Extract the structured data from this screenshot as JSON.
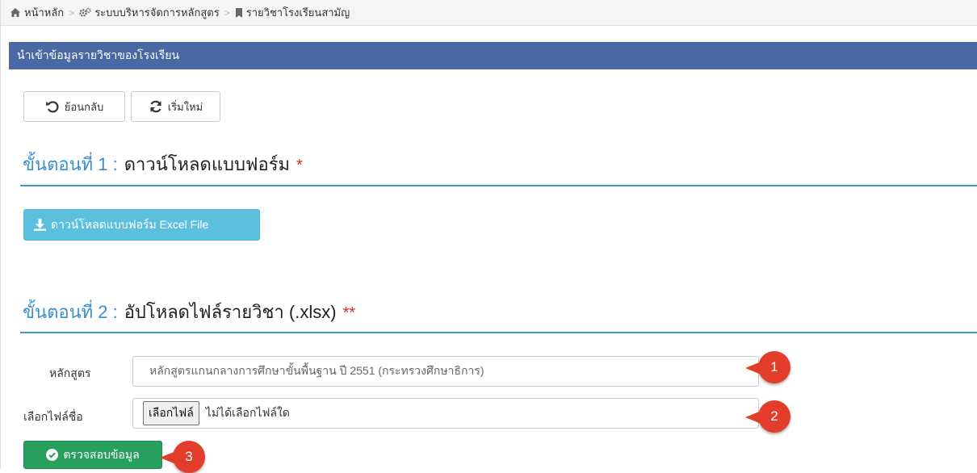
{
  "breadcrumb": {
    "home": "หน้าหลัก",
    "system": "ระบบบริหารจัดการหลักสูตร",
    "current": "รายวิชาโรงเรียนสามัญ"
  },
  "panel": {
    "title": "นำเข้าข้อมูลรายวิชาของโรงเรียน"
  },
  "toolbar": {
    "back_label": "ย้อนกลับ",
    "reset_label": "เริ่มใหม่"
  },
  "step1": {
    "number": "ขั้นตอนที่ 1 :",
    "title": "ดาวน์โหลดแบบฟอร์ม",
    "required": "*",
    "download_label": "ดาวน์โหลดแบบฟอร์ม Excel File"
  },
  "step2": {
    "number": "ขั้นตอนที่ 2 :",
    "title": "อัปโหลดไฟล์รายวิชา (.xlsx)",
    "required": "**"
  },
  "form": {
    "course_label": "หลักสูตร",
    "course_value": "หลักสูตรแกนกลางการศึกษาขั้นพื้นฐาน ปี 2551 (กระทรวงศึกษาธิการ)",
    "file_label": "เลือกไฟล์ชื่อ",
    "choose_file_label": "เลือกไฟล์",
    "no_file_text": "ไม่ได้เลือกไฟล์ใด",
    "verify_label": "ตรวจสอบข้อมูล"
  },
  "markers": [
    "1",
    "2",
    "3"
  ],
  "colors": {
    "panel_header": "#4a68a3",
    "step_number": "#3a8fd0",
    "info_button": "#5bc0de",
    "success_button": "#26a05c",
    "marker": "#e23c2a"
  }
}
